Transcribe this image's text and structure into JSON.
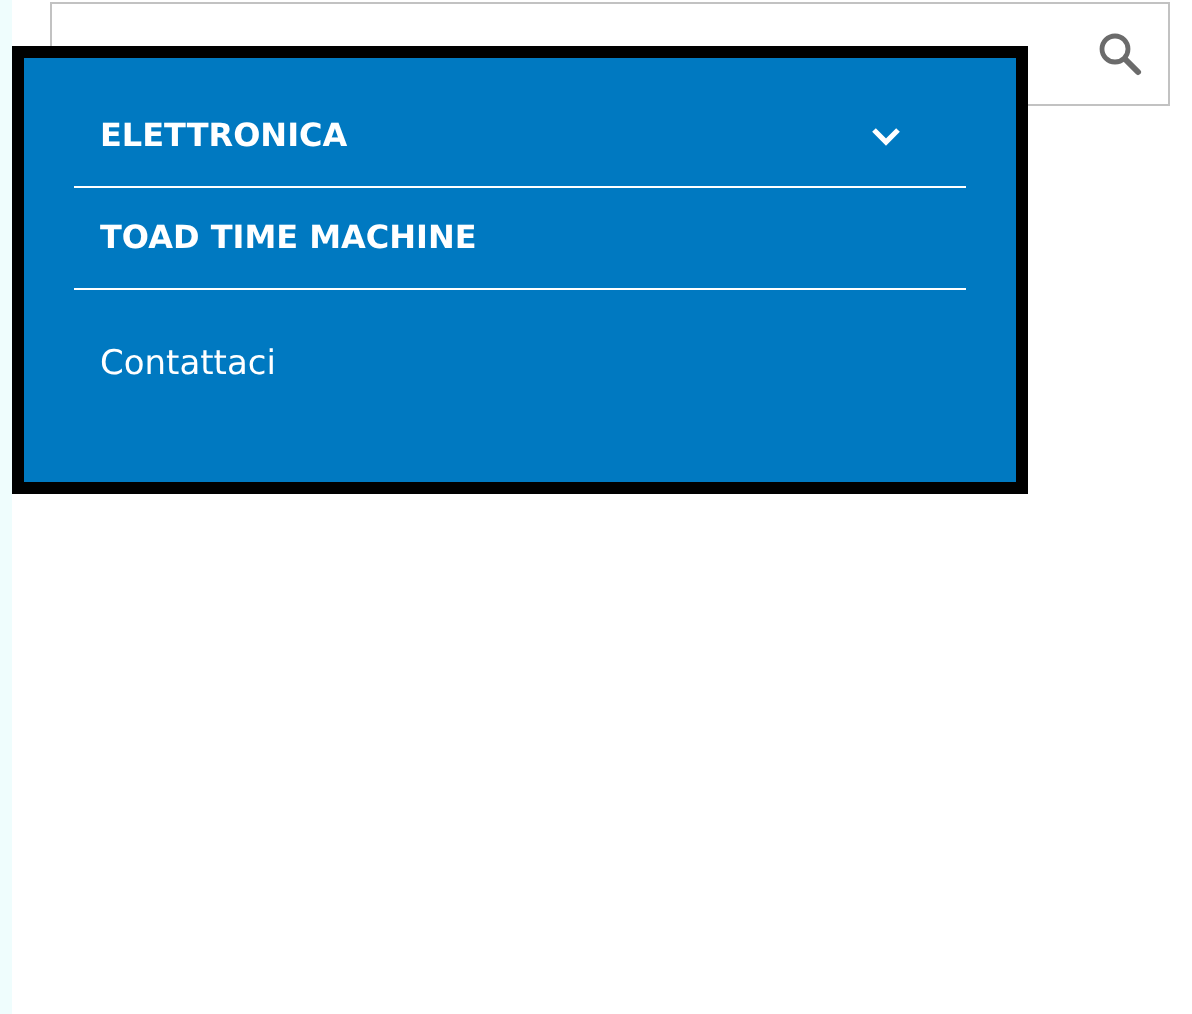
{
  "search": {
    "kind": "field"
  },
  "menu": {
    "items": [
      {
        "label": "ELETTRONICA",
        "kind": "category",
        "expandable": true
      },
      {
        "label": "TOAD TIME MACHINE",
        "kind": "category",
        "expandable": false
      },
      {
        "label": "Contattaci",
        "kind": "link",
        "expandable": false
      }
    ]
  }
}
